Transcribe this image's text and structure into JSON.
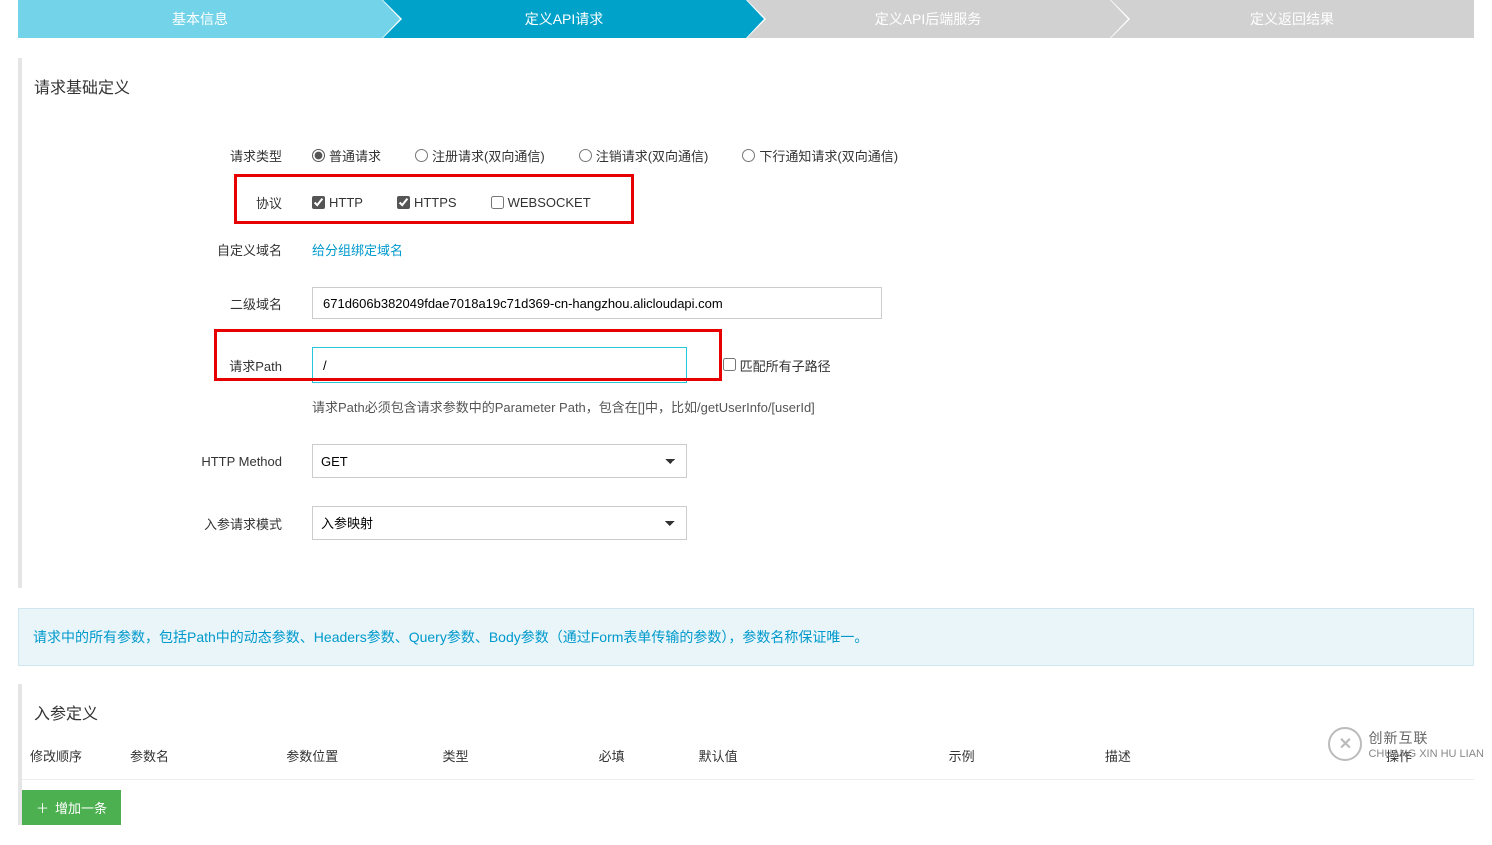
{
  "steps": [
    "基本信息",
    "定义API请求",
    "定义API后端服务",
    "定义返回结果"
  ],
  "panel1_title": "请求基础定义",
  "labels": {
    "req_type": "请求类型",
    "protocol": "协议",
    "custom_domain": "自定义域名",
    "second_domain": "二级域名",
    "req_path": "请求Path",
    "http_method": "HTTP Method",
    "param_mode": "入参请求模式"
  },
  "req_types": [
    "普通请求",
    "注册请求(双向通信)",
    "注销请求(双向通信)",
    "下行通知请求(双向通信)"
  ],
  "protocols": [
    "HTTP",
    "HTTPS",
    "WEBSOCKET"
  ],
  "custom_domain_link": "给分组绑定域名",
  "second_domain_value": "671d606b382049fdae7018a19c71d369-cn-hangzhou.alicloudapi.com",
  "req_path_value": "/",
  "match_all_label": "匹配所有子路径",
  "path_hint": "请求Path必须包含请求参数中的Parameter Path，包含在[]中，比如/getUserInfo/[userId]",
  "http_method_value": "GET",
  "param_mode_value": "入参映射",
  "info_text": "请求中的所有参数，包括Path中的动态参数、Headers参数、Query参数、Body参数（通过Form表单传输的参数），参数名称保证唯一。",
  "panel2_title": "入参定义",
  "columns": [
    "修改顺序",
    "参数名",
    "参数位置",
    "类型",
    "必填",
    "默认值",
    "示例",
    "描述",
    "操作"
  ],
  "add_btn": "增加一条",
  "footer_brand": "创新互联",
  "footer_sub": "CHUANG XIN HU LIAN"
}
